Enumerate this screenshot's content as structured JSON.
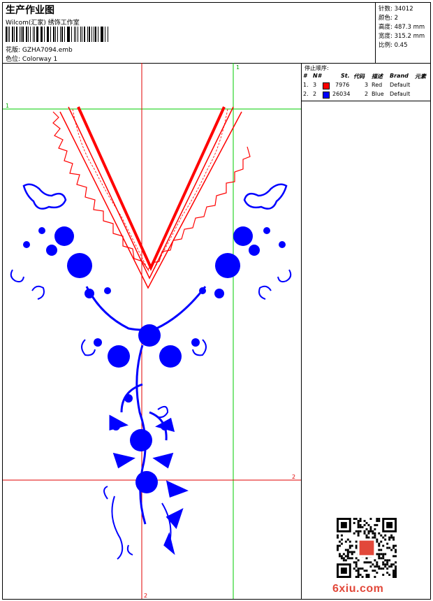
{
  "header": {
    "title": "生产作业图",
    "studio": "Wilcom(汇家) 绣饰工作室",
    "design_label": "花版:",
    "design_value": "GZHA7094.emb",
    "colorway_label": "色位:",
    "colorway_value": "Colorway 1"
  },
  "stats": {
    "stitches": "针数: 34012",
    "colors": "颜色: 2",
    "height": "高度: 487.3 mm",
    "width": "宽度: 315.2 mm",
    "scale": "比例: 0.45"
  },
  "legend": {
    "header": "停止顺序:",
    "columns": [
      "#",
      "N#",
      "St.",
      "代码",
      "描述",
      "Brand",
      "元素"
    ],
    "rows": [
      {
        "index": "1.",
        "needle": "3",
        "color": "#ff0000",
        "stitches": "7976",
        "code": "3",
        "desc": "Red",
        "brand": "Default"
      },
      {
        "index": "2.",
        "needle": "2",
        "color": "#0000ff",
        "stitches": "26034",
        "code": "2",
        "desc": "Blue",
        "brand": "Default"
      }
    ]
  },
  "guides": {
    "green_label_top": "1",
    "green_label_left": "1",
    "red_label_right": "2",
    "red_label_bottom": "2"
  },
  "watermark": "6xiu.com",
  "colors": {
    "red": "#ff0000",
    "blue": "#0000ff",
    "green_guide": "#00cc00",
    "red_guide": "#e00000"
  }
}
